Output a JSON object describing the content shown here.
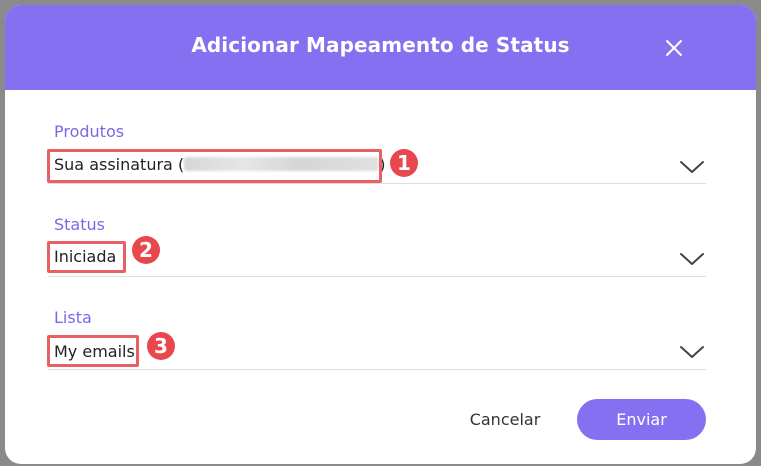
{
  "dialog": {
    "title": "Adicionar Mapeamento de Status",
    "close_icon": "close-icon"
  },
  "fields": [
    {
      "label": "Produtos",
      "value_prefix": "Sua assinatura (",
      "value_suffix": ")",
      "annotation_number": "1"
    },
    {
      "label": "Status",
      "value": "Iniciada",
      "annotation_number": "2"
    },
    {
      "label": "Lista",
      "value": "My emails",
      "annotation_number": "3"
    }
  ],
  "actions": {
    "cancel_label": "Cancelar",
    "submit_label": "Enviar"
  },
  "colors": {
    "accent": "#8470f0",
    "label": "#7b68e8",
    "annotation": "#e8474d"
  }
}
